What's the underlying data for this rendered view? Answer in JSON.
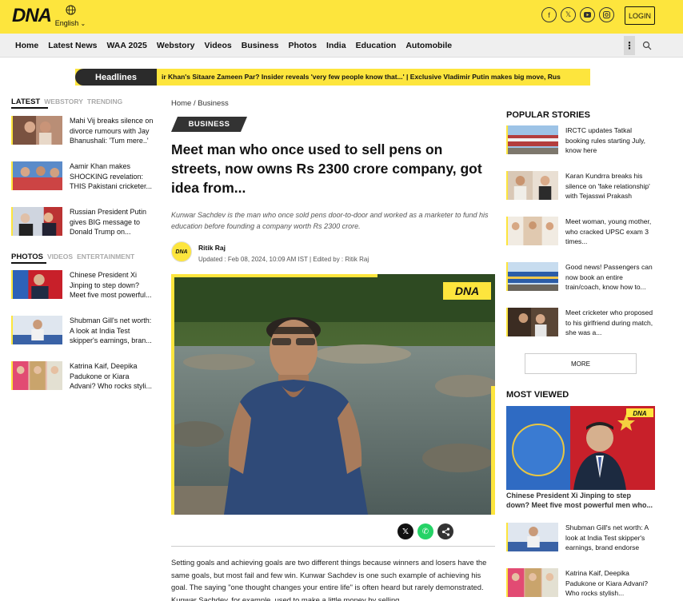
{
  "header": {
    "logo": "DNA",
    "language": "English",
    "login_label": "LOGIN",
    "socials": [
      "facebook-icon",
      "x-icon",
      "youtube-icon",
      "instagram-icon"
    ],
    "brand_color": "#fde53d"
  },
  "nav": {
    "items": [
      "Home",
      "Latest News",
      "WAA 2025",
      "Webstory",
      "Videos",
      "Business",
      "Photos",
      "India",
      "Education",
      "Automobile"
    ]
  },
  "ticker": {
    "label": "Headlines",
    "text": "ir Khan's Sitaare Zameen Par? Insider reveals 'very few people know that...' | Exclusive       Vladimir Putin makes big move, Rus"
  },
  "left": {
    "tabs1": [
      "LATEST",
      "WEBSTORY",
      "TRENDING"
    ],
    "latest": [
      "Mahi Vij breaks silence on divorce rumours with Jay Bhanushali: 'Tum mere..'",
      "Aamir Khan makes SHOCKING revelation: THIS Pakistani cricketer...",
      "Russian President Putin gives BIG message to Donald Trump on..."
    ],
    "tabs2": [
      "PHOTOS",
      "VIDEOS",
      "ENTERTAINMENT"
    ],
    "photos": [
      "Chinese President Xi Jinping to step down? Meet five most powerful...",
      "Shubman Gill's net worth: A look at India Test skipper's earnings, bran...",
      "Katrina Kaif, Deepika Padukone or Kiara Advani? Who rocks styli..."
    ]
  },
  "article": {
    "breadcrumb": "Home / Business",
    "category": "BUSINESS",
    "title": "Meet man who once used to sell pens on streets, now owns Rs 2300 crore company, got idea from...",
    "summary": "Kunwar Sachdev is the man who once sold pens door-to-door and worked as a marketer to fund his education before founding a company worth Rs 2300 crore.",
    "author": "Ritik Raj",
    "author_logo": "DNA",
    "updated": "Updated : Feb 08, 2024, 10:09 AM IST | Edited by : Ritik Raj",
    "image_watermark": "DNA",
    "body": "Setting goals and achieving goals are two different things because winners and losers have the same goals, but most fail and few win. Kunwar Sachdev is one such example of achieving his goal. The saying \"one thought changes your entire life\" is often heard but rarely demonstrated. Kunwar Sachdev, for example, used to make a little money by selling"
  },
  "right": {
    "popular_heading": "POPULAR STORIES",
    "popular": [
      "IRCTC updates Tatkal booking rules starting July, know here",
      "Karan Kundrra breaks his silence on 'fake relationship' with Tejasswi Prakash",
      "Meet woman, young mother, who cracked UPSC exam 3 times...",
      "Good news! Passengers can now book an entire train/coach, know how to...",
      "Meet cricketer who proposed to his girlfriend during match, she was a..."
    ],
    "more_label": "MORE",
    "most_viewed_heading": "MOST VIEWED",
    "mv_watermark": "DNA",
    "mv_feature": "Chinese President Xi Jinping to step down? Meet five most powerful men who...",
    "most_viewed": [
      "Shubman Gill's net worth: A look at India Test skipper's earnings, brand endorse",
      "Katrina Kaif, Deepika Padukone or Kiara Advani? Who rocks stylish..."
    ]
  }
}
